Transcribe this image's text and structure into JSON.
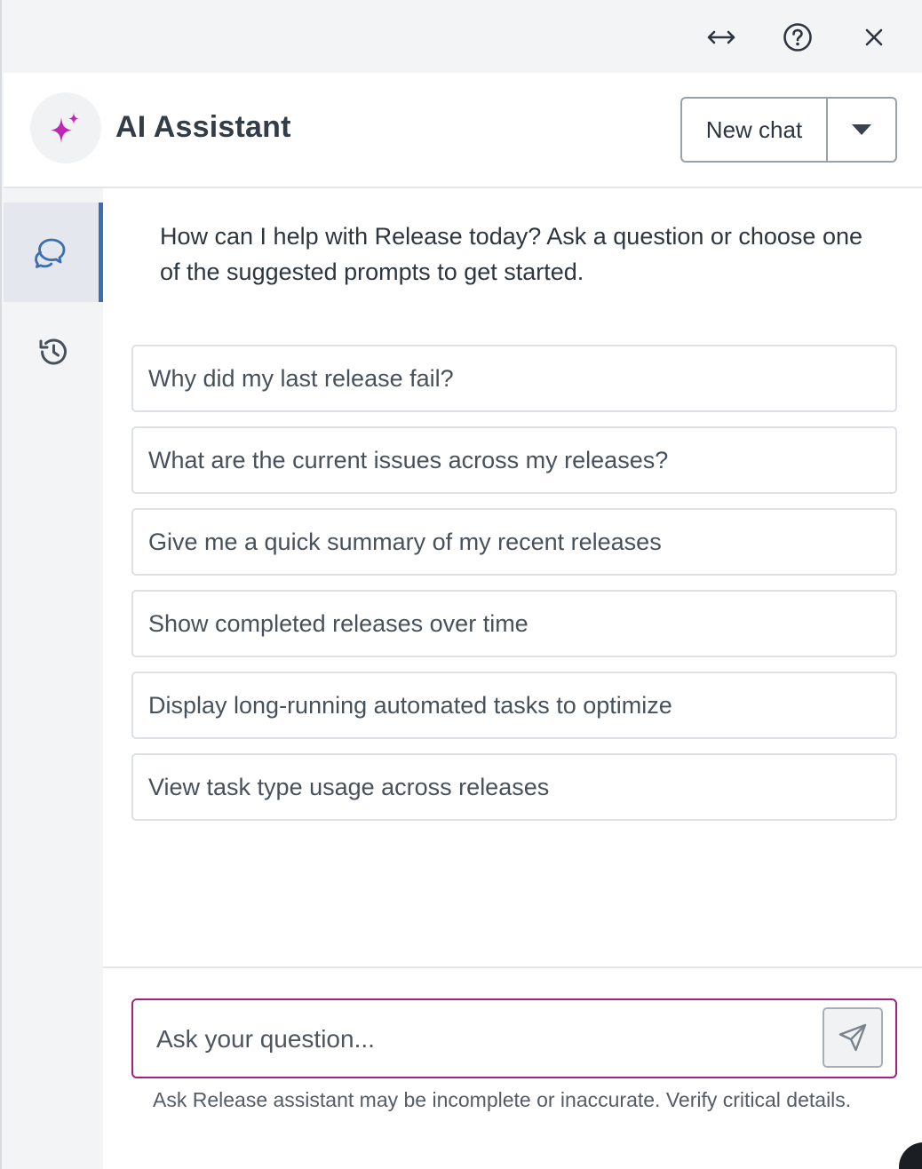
{
  "toolbar": {
    "icons": [
      "expand-horizontal-icon",
      "help-icon",
      "close-icon"
    ]
  },
  "header": {
    "title": "AI Assistant",
    "avatar_icon": "sparkle-icon",
    "new_chat_label": "New chat"
  },
  "rail": {
    "items": [
      {
        "icon": "chat-bubbles-icon",
        "active": true
      },
      {
        "icon": "history-icon",
        "active": false
      }
    ]
  },
  "main": {
    "intro": "How can I help with Release today? Ask a question or choose one of the suggested prompts to get started.",
    "prompts": [
      "Why did my last release fail?",
      "What are the current issues across my releases?",
      "Give me a quick summary of my recent releases",
      "Show completed releases over time",
      "Display long-running automated tasks to optimize",
      "View task type usage across releases"
    ]
  },
  "footer": {
    "input_value": "",
    "input_placeholder": "Ask your question...",
    "send_icon": "send-icon",
    "disclaimer": "Ask Release assistant may be incomplete or inaccurate. Verify critical details."
  },
  "colors": {
    "accent": "#a3207e",
    "sparkle": "#c026b8",
    "active_rail": "#3d6fb0"
  }
}
